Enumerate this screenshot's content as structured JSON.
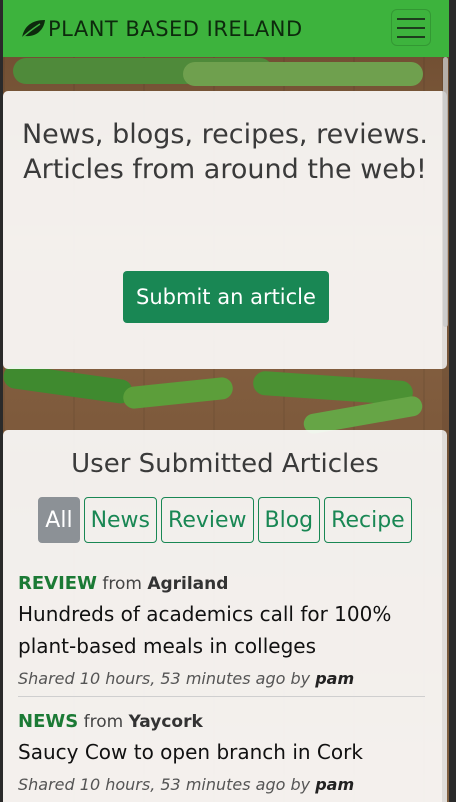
{
  "navbar": {
    "brand": "PLANT BASED IRELAND"
  },
  "hero": {
    "headline": "News, blogs, recipes, reviews. Articles from around the web!",
    "submit_label": "Submit an article"
  },
  "articles_section": {
    "title": "User Submitted Articles",
    "filters": [
      "All",
      "News",
      "Review",
      "Blog",
      "Recipe"
    ],
    "active_filter": "All",
    "items": [
      {
        "category": "REVIEW",
        "from_word": "from",
        "source": "Agriland",
        "title": "Hundreds of academics call for 100% plant-based meals in colleges",
        "shared_prefix": "Shared 10 hours, 53 minutes ago by",
        "author": "pam"
      },
      {
        "category": "NEWS",
        "from_word": "from",
        "source": "Yaycork",
        "title": "Saucy Cow to open branch in Cork",
        "shared_prefix": "Shared 10 hours, 53 minutes ago by",
        "author": "pam"
      }
    ]
  },
  "colors": {
    "navbar": "#3db33d",
    "button": "#198754",
    "active_filter": "#8c9196"
  }
}
